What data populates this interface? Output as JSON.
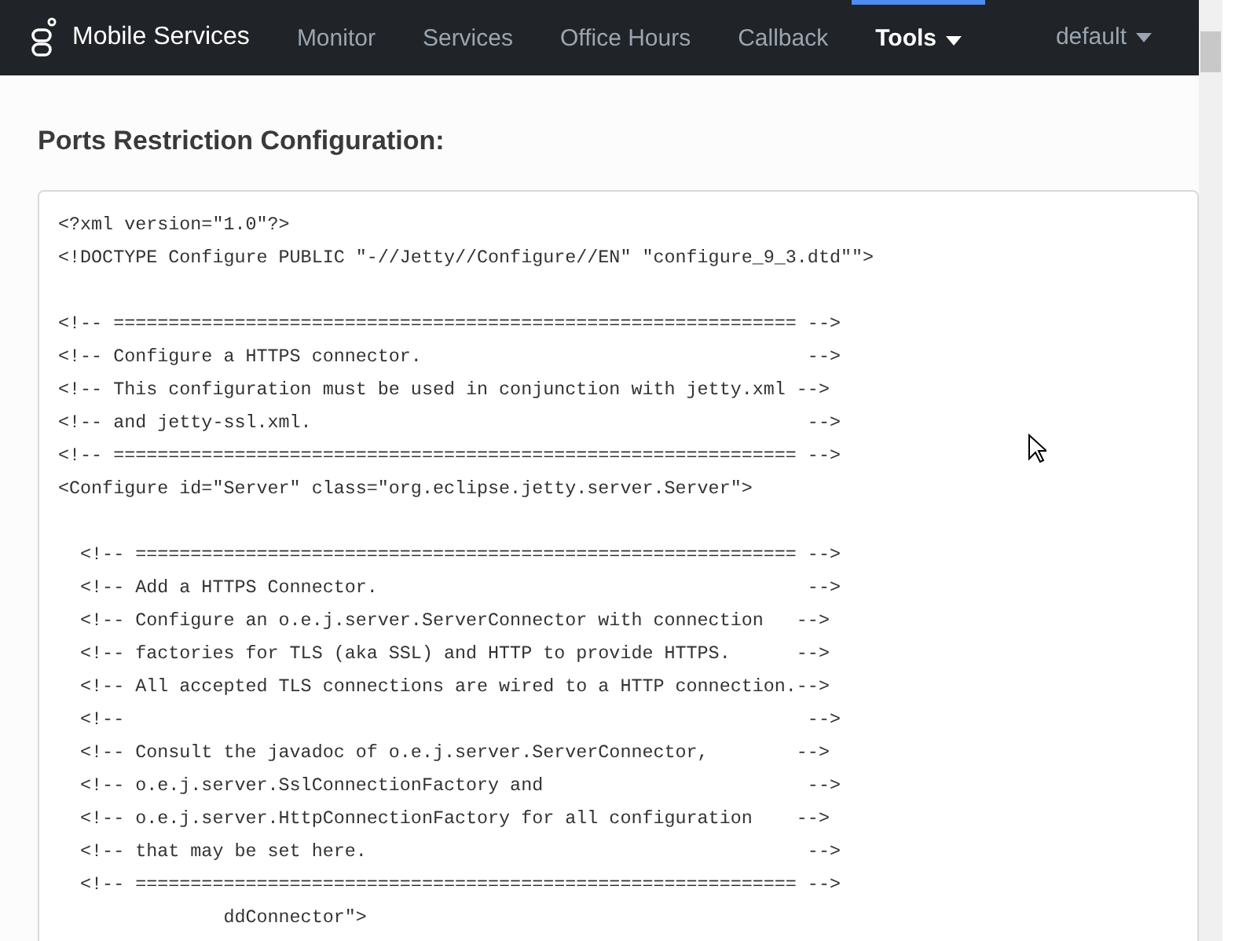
{
  "navbar": {
    "brand": "Mobile Services",
    "items": [
      {
        "label": "Monitor",
        "kind": "link",
        "selected": false
      },
      {
        "label": "Services",
        "kind": "link",
        "selected": false
      },
      {
        "label": "Office Hours",
        "kind": "link",
        "selected": false
      },
      {
        "label": "Callback",
        "kind": "link",
        "selected": false
      },
      {
        "label": "Tools",
        "kind": "dropdown",
        "selected": true
      }
    ],
    "user_menu": {
      "label": "default",
      "kind": "dropdown"
    }
  },
  "page": {
    "heading": "Ports Restriction Configuration:",
    "code": "<?xml version=\"1.0\"?>\n<!DOCTYPE Configure PUBLIC \"-//Jetty//Configure//EN\" \"configure_9_3.dtd\"\">\n\n<!-- ============================================================== -->\n<!-- Configure a HTTPS connector.                                   -->\n<!-- This configuration must be used in conjunction with jetty.xml -->\n<!-- and jetty-ssl.xml.                                             -->\n<!-- ============================================================== -->\n<Configure id=\"Server\" class=\"org.eclipse.jetty.server.Server\">\n\n  <!-- ============================================================ -->\n  <!-- Add a HTTPS Connector.                                       -->\n  <!-- Configure an o.e.j.server.ServerConnector with connection   -->\n  <!-- factories for TLS (aka SSL) and HTTP to provide HTTPS.      -->\n  <!-- All accepted TLS connections are wired to a HTTP connection.-->\n  <!--                                                              -->\n  <!-- Consult the javadoc of o.e.j.server.ServerConnector,        -->\n  <!-- o.e.j.server.SslConnectionFactory and                        -->\n  <!-- o.e.j.server.HttpConnectionFactory for all configuration    -->\n  <!-- that may be set here.                                        -->\n  <!-- ============================================================ -->\n               ddConnector\">"
  }
}
